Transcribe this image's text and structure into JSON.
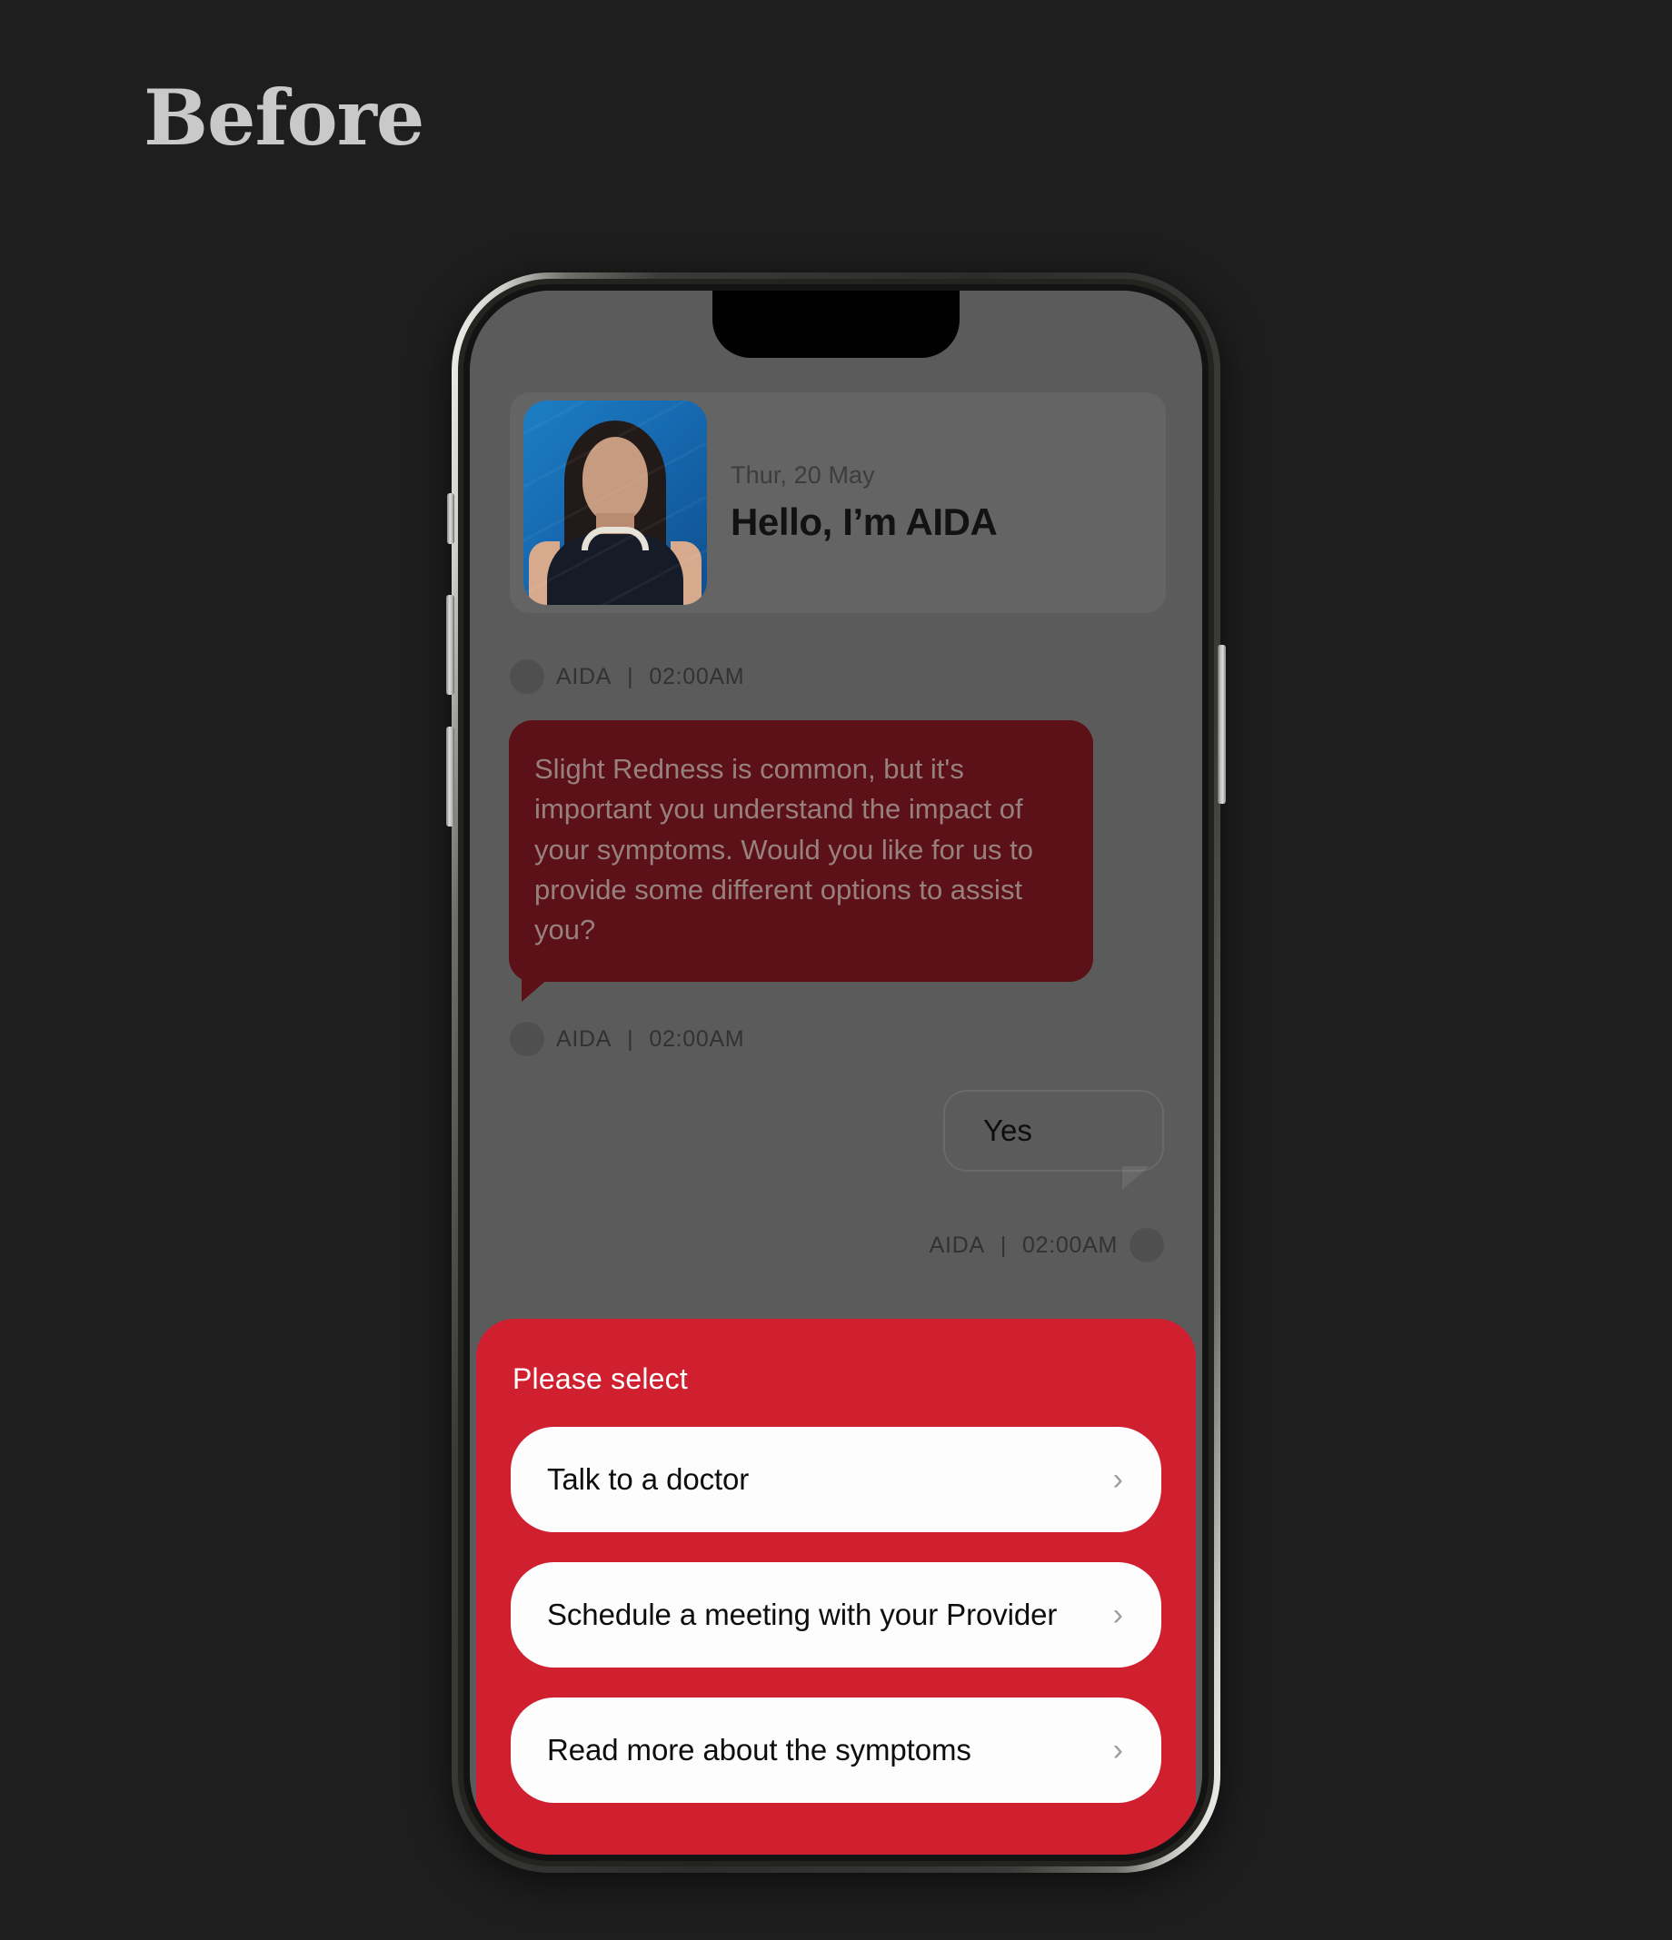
{
  "page": {
    "label": "Before",
    "background_color": "#1e1e1e",
    "label_color": "#c9c9c9"
  },
  "device": {
    "type": "iphone-mockup",
    "frame_color": "#2c2c2b",
    "screen_overlay": "dimmed",
    "buttons": {
      "silence_switch": "silence-switch",
      "volume_up": "volume-up-button",
      "volume_down": "volume-down-button",
      "power": "power-button"
    },
    "dynamic_island": "dynamic-island"
  },
  "app": {
    "header": {
      "avatar_alt": "AIDA assistant portrait",
      "date": "Thur, 20 May",
      "title": "Hello, I’m AIDA"
    },
    "messages": [
      {
        "sender": "AIDA",
        "separator": "|",
        "time": "02:00AM",
        "side": "left",
        "meta_position": "above"
      },
      {
        "text": "Slight Redness is common, but it's important you understand the impact of your symptoms. Would you like for us to provide some different options to assist you?",
        "side": "left",
        "bubble_color": "#5c1018",
        "sender": "AIDA",
        "separator": "|",
        "time": "02:00AM"
      },
      {
        "text": "Yes",
        "side": "right",
        "bubble_color": "transparent",
        "sender": "AIDA",
        "separator": "|",
        "time": "02:00AM"
      }
    ],
    "action_sheet": {
      "title": "Please select",
      "background_color": "#d0202f",
      "options": [
        {
          "label": "Talk to a doctor",
          "chevron": "›"
        },
        {
          "label": "Schedule a meeting with your Provider",
          "chevron": "›"
        },
        {
          "label": "Read more about the symptoms",
          "chevron": "›"
        }
      ]
    }
  }
}
